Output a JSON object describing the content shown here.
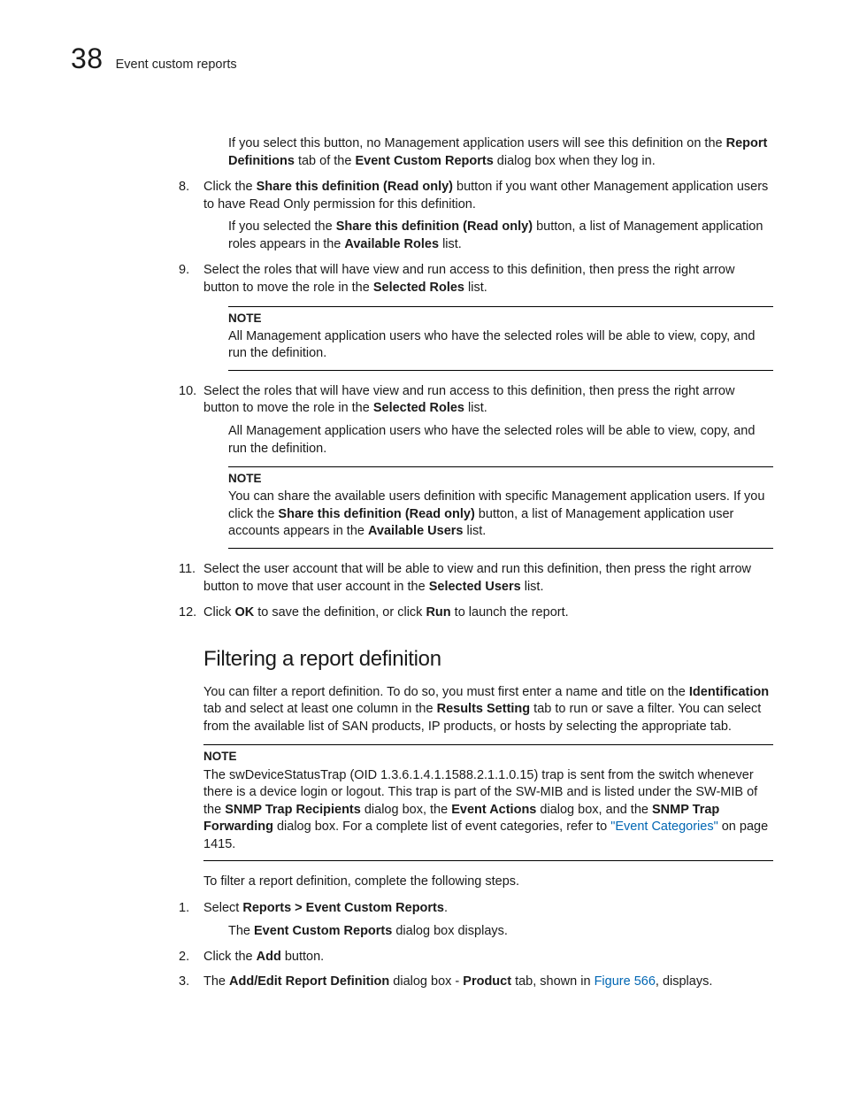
{
  "header": {
    "chapter_number": "38",
    "chapter_title": "Event custom reports"
  },
  "intro": {
    "p1a": "If you select this button, no Management application users will see this definition on the ",
    "p1b_bold": "Report Definitions",
    "p1c": " tab of the ",
    "p1d_bold": "Event Custom Reports",
    "p1e": " dialog box when they log in."
  },
  "step8": {
    "num": "8.",
    "a": "Click the ",
    "b_bold": "Share this definition (Read only)",
    "c": " button if you want other Management application users to have Read Only permission for this definition.",
    "sub_a": "If you selected the ",
    "sub_b_bold": "Share this definition (Read only)",
    "sub_c": " button, a list of Management application roles appears in the ",
    "sub_d_bold": "Available Roles",
    "sub_e": " list."
  },
  "step9": {
    "num": "9.",
    "a": "Select the roles that will have view and run access to this definition, then press the right arrow button to move the role in the ",
    "b_bold": "Selected Roles",
    "c": " list.",
    "note_label": "NOTE",
    "note_body": "All Management application users who have the selected roles will be able to view, copy, and run the definition."
  },
  "step10": {
    "num": "10.",
    "a": "Select the roles that will have view and run access to this definition, then press the right arrow button to move the role in the ",
    "b_bold": "Selected Roles",
    "c": " list.",
    "sub": "All Management application users who have the selected roles will be able to view, copy, and run the definition.",
    "note_label": "NOTE",
    "note_a": "You can share the available users definition with specific Management application users. If you click the ",
    "note_b_bold": "Share this definition (Read only)",
    "note_c": " button, a list of Management application user accounts appears in the ",
    "note_d_bold": "Available Users",
    "note_e": " list."
  },
  "step11": {
    "num": "11.",
    "a": "Select the user account that will be able to view and run this definition, then press the right arrow button to move that user account in the ",
    "b_bold": "Selected Users",
    "c": " list."
  },
  "step12": {
    "num": "12.",
    "a": "Click ",
    "b_bold": "OK",
    "c": " to save the definition, or click ",
    "d_bold": "Run",
    "e": " to launch the report."
  },
  "h2": "Filtering a report definition",
  "filter_intro": {
    "a": "You can filter a report definition. To do so, you must first enter a name and title on the ",
    "b_bold": "Identification",
    "c": " tab and select at least one column in the ",
    "d_bold": "Results Setting",
    "e": " tab to run or save a filter. You can select from the available list of SAN products, IP products, or hosts by selecting the appropriate tab."
  },
  "filter_note": {
    "label": "NOTE",
    "a": "The swDeviceStatusTrap (OID 1.3.6.1.4.1.1588.2.1.1.0.15) trap is sent from the switch whenever there is a device login or logout. This trap is part of the SW-MIB and is listed under the SW-MIB of the ",
    "b_bold": "SNMP Trap Recipients",
    "c": " dialog box, the ",
    "d_bold": "Event Actions",
    "e": " dialog box, and the ",
    "f_bold": "SNMP Trap Forwarding",
    "g": " dialog box. For a complete list of event categories, refer to ",
    "link": "\"Event Categories\"",
    "h": " on page 1415."
  },
  "filter_lead": "To filter a report definition, complete the following steps.",
  "fstep1": {
    "num": "1.",
    "a": "Select ",
    "b_bold": "Reports > Event Custom Reports",
    "c": ".",
    "sub_a": "The ",
    "sub_b_bold": "Event Custom Reports",
    "sub_c": " dialog box displays."
  },
  "fstep2": {
    "num": "2.",
    "a": "Click the ",
    "b_bold": "Add",
    "c": " button."
  },
  "fstep3": {
    "num": "3.",
    "a": "The ",
    "b_bold": "Add/Edit Report Definition",
    "c": " dialog box - ",
    "d_bold": "Product",
    "e": " tab, shown in ",
    "link": "Figure 566",
    "f": ", displays."
  }
}
